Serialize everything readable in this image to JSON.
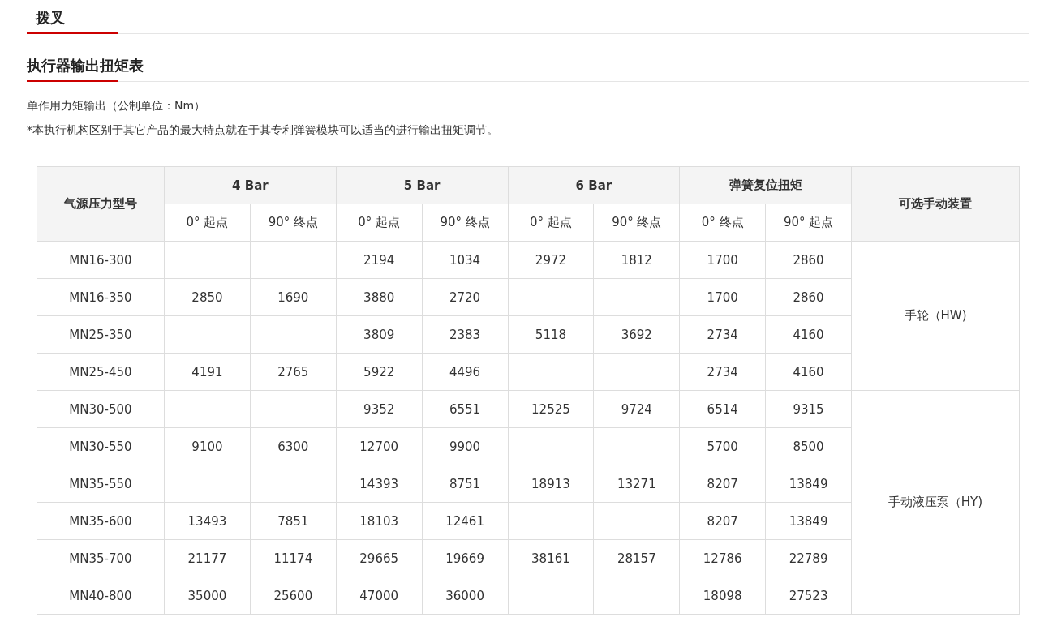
{
  "tabs": [
    {
      "label": "拨叉",
      "selected": true
    }
  ],
  "section": {
    "title": "执行器输出扭矩表",
    "notes": [
      "单作用力矩输出（公制单位：Nm）",
      "*本执行机构区别于其它产品的最大特点就在于其专利弹簧模块可以适当的进行输出扭矩调节。"
    ]
  },
  "table": {
    "model_header": "气源压力型号",
    "device_header": "可选手动装置",
    "groups": [
      {
        "title": "4 Bar",
        "columns": [
          "0° 起点",
          "90° 终点"
        ]
      },
      {
        "title": "5 Bar",
        "columns": [
          "0° 起点",
          "90° 终点"
        ]
      },
      {
        "title": "6 Bar",
        "columns": [
          "0° 起点",
          "90° 终点"
        ]
      },
      {
        "title": "弹簧复位扭矩",
        "columns": [
          "0° 终点",
          "90° 起点"
        ]
      }
    ],
    "sections": [
      {
        "device": "手轮（HW)",
        "rows": [
          {
            "model": "MN16-300",
            "bar_5": [
              "2194",
              "1034"
            ],
            "bar_6": [
              "2972",
              "1812"
            ],
            "spring": [
              "1700",
              "2860"
            ]
          },
          {
            "model": "MN16-350",
            "bar_4": [
              "2850",
              "1690"
            ],
            "bar_5": [
              "3880",
              "2720"
            ],
            "spring": [
              "1700",
              "2860"
            ]
          },
          {
            "model": "MN25-350",
            "bar_5": [
              "3809",
              "2383"
            ],
            "bar_6": [
              "5118",
              "3692"
            ],
            "spring": [
              "2734",
              "4160"
            ]
          },
          {
            "model": "MN25-450",
            "bar_4": [
              "4191",
              "2765"
            ],
            "bar_5": [
              "5922",
              "4496"
            ],
            "spring": [
              "2734",
              "4160"
            ]
          }
        ]
      },
      {
        "device": "手动液压泵（HY)",
        "rows": [
          {
            "model": "MN30-500",
            "bar_5": [
              "9352",
              "6551"
            ],
            "bar_6": [
              "12525",
              "9724"
            ],
            "spring": [
              "6514",
              "9315"
            ]
          },
          {
            "model": "MN30-550",
            "bar_4": [
              "9100",
              "6300"
            ],
            "bar_5": [
              "12700",
              "9900"
            ],
            "spring": [
              "5700",
              "8500"
            ]
          },
          {
            "model": "MN35-550",
            "bar_5": [
              "14393",
              "8751"
            ],
            "bar_6": [
              "18913",
              "13271"
            ],
            "spring": [
              "8207",
              "13849"
            ]
          },
          {
            "model": "MN35-600",
            "bar_4": [
              "13493",
              "7851"
            ],
            "bar_5": [
              "18103",
              "12461"
            ],
            "spring": [
              "8207",
              "13849"
            ]
          },
          {
            "model": "MN35-700",
            "bar_4": [
              "21177",
              "11174"
            ],
            "bar_5": [
              "29665",
              "19669"
            ],
            "bar_6": [
              "38161",
              "28157"
            ],
            "spring": [
              "12786",
              "22789"
            ]
          },
          {
            "model": "MN40-800",
            "bar_4": [
              "35000",
              "25600"
            ],
            "bar_5": [
              "47000",
              "36000"
            ],
            "spring": [
              "18098",
              "27523"
            ]
          }
        ]
      }
    ]
  }
}
